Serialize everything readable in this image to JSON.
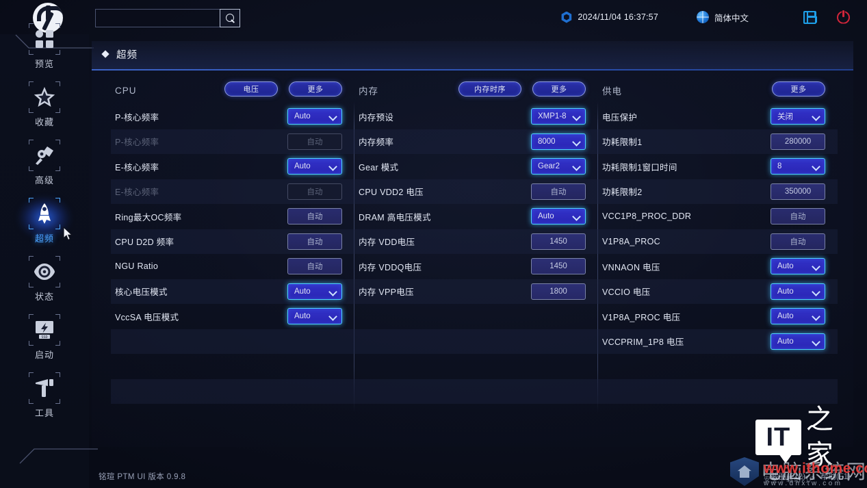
{
  "header": {
    "logo_icon": "brand-logo-icon",
    "search_placeholder": "",
    "search_value": "",
    "search_icon": "search-icon",
    "settings_icon": "hex-gear-icon",
    "datetime": "2024/11/04 16:37:57",
    "globe_icon": "globe-icon",
    "language": "简体中文",
    "save_icon": "save-icon",
    "power_icon": "power-icon"
  },
  "sidebar": {
    "items": [
      {
        "label": "预览",
        "icon": "grid-squares-icon",
        "active": false
      },
      {
        "label": "收藏",
        "icon": "star-icon",
        "active": false
      },
      {
        "label": "高级",
        "icon": "pen-tool-icon",
        "active": false
      },
      {
        "label": "超频",
        "icon": "rocket-icon",
        "active": true
      },
      {
        "label": "状态",
        "icon": "eye-target-icon",
        "active": false
      },
      {
        "label": "启动",
        "icon": "boot-lightning-icon",
        "active": false
      },
      {
        "label": "工具",
        "icon": "hammer-tool-icon",
        "active": false
      }
    ]
  },
  "tab": {
    "diamond_icon": "diamond-bullet-icon",
    "label": "超频"
  },
  "columns": [
    {
      "key": "cpu",
      "title": "CPU",
      "buttons": [
        {
          "label": "电压",
          "name": "cpu-voltage-button"
        },
        {
          "label": "更多",
          "name": "cpu-more-button"
        }
      ],
      "rows": [
        {
          "label": "P-核心频率",
          "value": "Auto",
          "type": "dropdown",
          "disabled": false
        },
        {
          "label": "P-核心频率",
          "value": "自动",
          "type": "disabledbox",
          "disabled": true
        },
        {
          "label": "E-核心频率",
          "value": "Auto",
          "type": "dropdown",
          "disabled": false
        },
        {
          "label": "E-核心频率",
          "value": "自动",
          "type": "disabledbox",
          "disabled": true
        },
        {
          "label": "Ring最大OC频率",
          "value": "自动",
          "type": "valuebox",
          "disabled": false
        },
        {
          "label": "CPU D2D 频率",
          "value": "自动",
          "type": "valuebox",
          "disabled": false
        },
        {
          "label": "NGU Ratio",
          "value": "自动",
          "type": "valuebox",
          "disabled": false
        },
        {
          "label": "核心电压模式",
          "value": "Auto",
          "type": "dropdown",
          "disabled": false
        },
        {
          "label": "VccSA 电压模式",
          "value": "Auto",
          "type": "dropdown",
          "disabled": false
        },
        {
          "label": "",
          "value": "",
          "type": "empty",
          "disabled": false
        },
        {
          "label": "",
          "value": "",
          "type": "empty",
          "disabled": false
        },
        {
          "label": "",
          "value": "",
          "type": "empty",
          "disabled": false
        }
      ]
    },
    {
      "key": "memory",
      "title": "内存",
      "buttons": [
        {
          "label": "内存时序",
          "name": "memory-timing-button"
        },
        {
          "label": "更多",
          "name": "memory-more-button"
        }
      ],
      "rows": [
        {
          "label": "内存预设",
          "value": "XMP1-8",
          "type": "dropdown",
          "disabled": false
        },
        {
          "label": "内存频率",
          "value": "8000",
          "type": "dropdown",
          "disabled": false
        },
        {
          "label": "Gear 模式",
          "value": "Gear2",
          "type": "dropdown",
          "disabled": false
        },
        {
          "label": "CPU VDD2 电压",
          "value": "自动",
          "type": "valuebox",
          "disabled": false
        },
        {
          "label": "DRAM 高电压模式",
          "value": "Auto",
          "type": "dropdown",
          "disabled": false
        },
        {
          "label": "内存 VDD电压",
          "value": "1450",
          "type": "numbox",
          "disabled": false
        },
        {
          "label": "内存 VDDQ电压",
          "value": "1450",
          "type": "numbox",
          "disabled": false
        },
        {
          "label": "内存 VPP电压",
          "value": "1800",
          "type": "numbox",
          "disabled": false
        },
        {
          "label": "",
          "value": "",
          "type": "empty",
          "disabled": false
        },
        {
          "label": "",
          "value": "",
          "type": "empty",
          "disabled": false
        },
        {
          "label": "",
          "value": "",
          "type": "empty",
          "disabled": false
        },
        {
          "label": "",
          "value": "",
          "type": "empty",
          "disabled": false
        }
      ]
    },
    {
      "key": "power",
      "title": "供电",
      "buttons": [
        {
          "label": "更多",
          "name": "power-more-button"
        }
      ],
      "rows": [
        {
          "label": "电压保护",
          "value": "关闭",
          "type": "dropdown",
          "disabled": false
        },
        {
          "label": "功耗限制1",
          "value": "280000",
          "type": "numbox",
          "disabled": false
        },
        {
          "label": "功耗限制1窗口时间",
          "value": "8",
          "type": "dropdown",
          "disabled": false
        },
        {
          "label": "功耗限制2",
          "value": "350000",
          "type": "numbox",
          "disabled": false
        },
        {
          "label": "VCC1P8_PROC_DDR",
          "value": "自动",
          "type": "valuebox",
          "disabled": false
        },
        {
          "label": "V1P8A_PROC",
          "value": "自动",
          "type": "valuebox",
          "disabled": false
        },
        {
          "label": "VNNAON 电压",
          "value": "Auto",
          "type": "dropdown",
          "disabled": false
        },
        {
          "label": "VCCIO 电压",
          "value": "Auto",
          "type": "dropdown",
          "disabled": false
        },
        {
          "label": "V1P8A_PROC 电压",
          "value": "Auto",
          "type": "dropdown",
          "disabled": false
        },
        {
          "label": "VCCPRIM_1P8 电压",
          "value": "Auto",
          "type": "dropdown",
          "disabled": false
        },
        {
          "label": "",
          "value": "",
          "type": "empty",
          "disabled": false
        },
        {
          "label": "",
          "value": "",
          "type": "empty",
          "disabled": false
        }
      ]
    }
  ],
  "footer": {
    "version": "铭瑄 PTM UI 版本 0.9.8",
    "screenshot": "截图(F12)",
    "help": "帮助(F1)"
  },
  "watermarks": {
    "ithome_it": "IT",
    "ithome_jia": "之家",
    "ithome_url": "www.ithome.com",
    "dnxtw_cn": "电脑系统网",
    "dnxtw_sub": "安全下载站门户",
    "dnxtw_url": "www.dnxtw.com"
  },
  "colors": {
    "accent_blue": "#4da6ff",
    "glow_cyan": "#4fd2ff",
    "pill_fill": "#2a2fa8",
    "power_red": "#d1253a",
    "save_blue": "#1e9fe8"
  }
}
